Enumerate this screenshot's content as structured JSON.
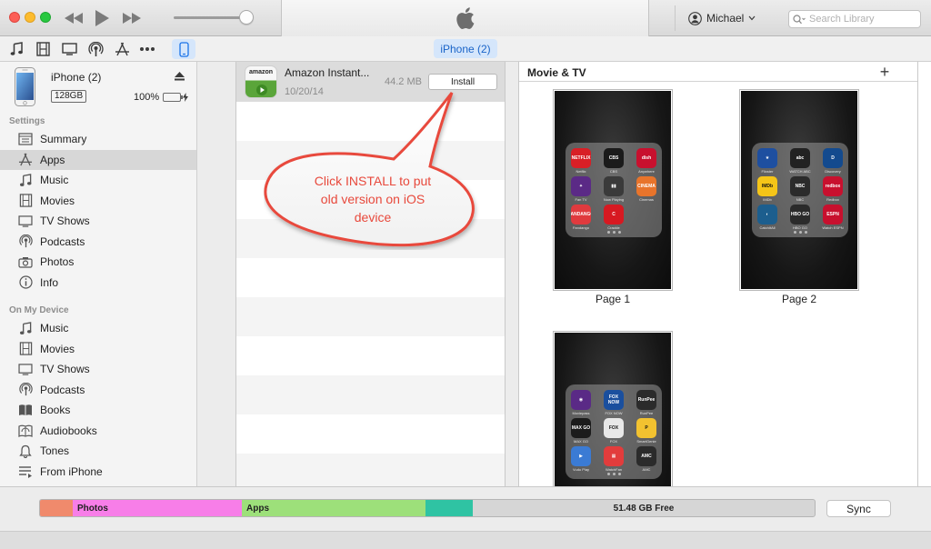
{
  "titlebar": {
    "account_name": "Michael",
    "search_placeholder": "Search Library"
  },
  "toolbar": {
    "device_pill": "iPhone (2)",
    "icons": [
      "music-note-icon",
      "film-icon",
      "tv-icon",
      "podcast-icon",
      "app-store-icon",
      "more-icon",
      "iphone-icon"
    ]
  },
  "device": {
    "name": "iPhone (2)",
    "capacity": "128GB",
    "battery": "100%"
  },
  "sidebar": {
    "settings_header": "Settings",
    "settings_items": [
      {
        "label": "Summary",
        "icon": "summary-icon"
      },
      {
        "label": "Apps",
        "icon": "apps-icon",
        "selected": true
      },
      {
        "label": "Music",
        "icon": "music-note-icon"
      },
      {
        "label": "Movies",
        "icon": "film-icon"
      },
      {
        "label": "TV Shows",
        "icon": "tv-icon"
      },
      {
        "label": "Podcasts",
        "icon": "podcast-icon"
      },
      {
        "label": "Photos",
        "icon": "camera-icon"
      },
      {
        "label": "Info",
        "icon": "info-icon"
      }
    ],
    "device_header": "On My Device",
    "device_items": [
      {
        "label": "Music",
        "icon": "music-note-icon"
      },
      {
        "label": "Movies",
        "icon": "film-icon"
      },
      {
        "label": "TV Shows",
        "icon": "tv-icon"
      },
      {
        "label": "Podcasts",
        "icon": "podcast-icon"
      },
      {
        "label": "Books",
        "icon": "book-icon"
      },
      {
        "label": "Audiobooks",
        "icon": "audiobook-icon"
      },
      {
        "label": "Tones",
        "icon": "bell-icon"
      },
      {
        "label": "From iPhone",
        "icon": "list-icon"
      }
    ]
  },
  "app_list": {
    "app": {
      "icon_text": "amazon",
      "title": "Amazon Instant...",
      "date": "10/20/14",
      "size": "44.2 MB",
      "install_label": "Install"
    }
  },
  "callout": {
    "line1": "Click INSTALL to put",
    "line2": "old version on iOS",
    "line3": "device",
    "color": "#e8493c"
  },
  "home_screens": {
    "section_title": "Movie & TV",
    "add_label": "+",
    "pages": [
      {
        "label": "Page 1",
        "apps": [
          {
            "name": "Netflix",
            "text": "NETFLIX",
            "color": "#d81f26"
          },
          {
            "name": "CBS",
            "text": "CBS",
            "color": "#1b1b1b"
          },
          {
            "name": "Anywhere",
            "text": "dish",
            "color": "#c8102e"
          },
          {
            "name": "Fan TV",
            "text": "✦",
            "color": "#5b2a86"
          },
          {
            "name": "Now Playing",
            "text": "▮▮",
            "color": "#3a3a3a"
          },
          {
            "name": "Cinemas",
            "text": "CINEMA",
            "color": "#e8742b"
          },
          {
            "name": "Fandango",
            "text": "FANDANGO",
            "color": "#e03a3e"
          },
          {
            "name": "Crackle",
            "text": "C",
            "color": "#d71921"
          }
        ]
      },
      {
        "label": "Page 2",
        "apps": [
          {
            "name": "Flixster",
            "text": "★",
            "color": "#1e4fa0"
          },
          {
            "name": "WATCH ABC",
            "text": "abc",
            "color": "#222222"
          },
          {
            "name": "Discovery",
            "text": "D",
            "color": "#134a8e"
          },
          {
            "name": "IMDb",
            "text": "IMDb",
            "color": "#f5c518"
          },
          {
            "name": "NBC",
            "text": "NBC",
            "color": "#2b2b2b"
          },
          {
            "name": "Redbox",
            "text": "redbox",
            "color": "#c8102e"
          },
          {
            "name": "CatchItAll",
            "text": "◐",
            "color": "#1c5e8e"
          },
          {
            "name": "HBO GO",
            "text": "HBO GO",
            "color": "#2b2b2b"
          },
          {
            "name": "Watch ESPN",
            "text": "ESPN",
            "color": "#c8102e"
          }
        ]
      },
      {
        "label": "",
        "apps": [
          {
            "name": "Moviepass",
            "text": "◉",
            "color": "#5a2a86"
          },
          {
            "name": "FOX NOW",
            "text": "FOX NOW",
            "color": "#1a4f9e"
          },
          {
            "name": "RunPee",
            "text": "RunPee",
            "color": "#2b2b2b"
          },
          {
            "name": "MAX GO",
            "text": "MAX GO",
            "color": "#1b1b1b"
          },
          {
            "name": "FOX",
            "text": "FOX",
            "color": "#e8e8e8"
          },
          {
            "name": "SmartGenie",
            "text": "P",
            "color": "#f2c230"
          },
          {
            "name": "Vudu Play",
            "text": "▶",
            "color": "#3b7bd4"
          },
          {
            "name": "WatchFan",
            "text": "▦",
            "color": "#e23c3c"
          },
          {
            "name": "AMC",
            "text": "AMC",
            "color": "#2b2b2b"
          }
        ]
      }
    ]
  },
  "capacity": {
    "segments": [
      {
        "label": "",
        "color": "#f08a6c",
        "fraction": 0.042
      },
      {
        "label": "Photos",
        "color": "#f77ee8",
        "fraction": 0.218
      },
      {
        "label": "Apps",
        "color": "#9de07a",
        "fraction": 0.237
      },
      {
        "label": "",
        "color": "#2fc3a3",
        "fraction": 0.061
      }
    ],
    "free_label": "51.48 GB Free",
    "sync_label": "Sync"
  }
}
